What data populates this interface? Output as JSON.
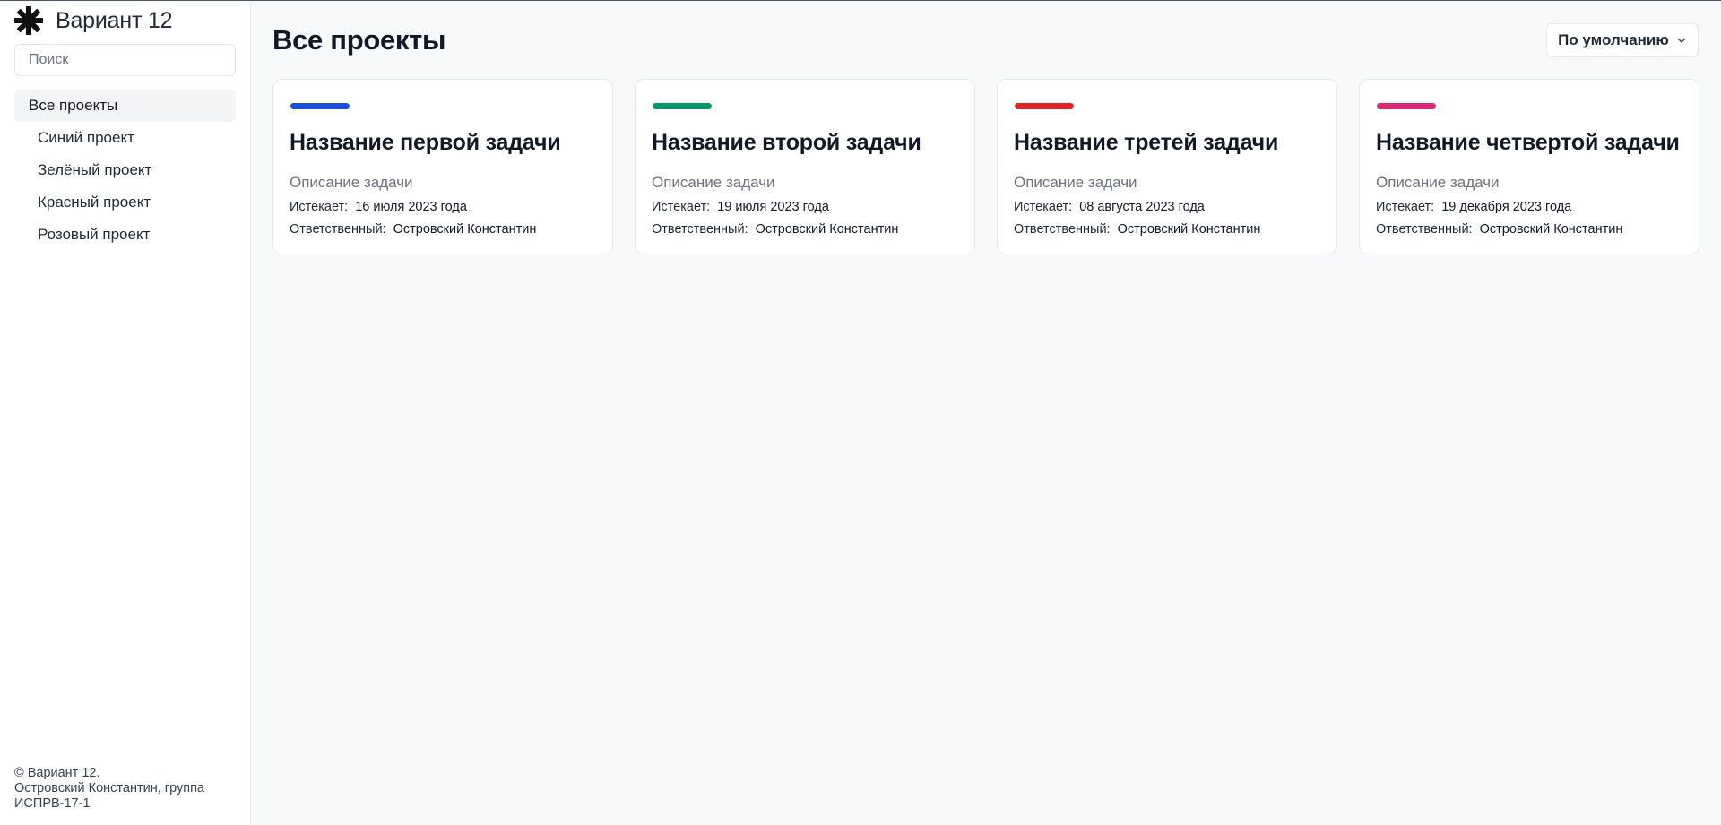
{
  "app": {
    "title": "Вариант 12",
    "logo_icon": "asterisk-icon"
  },
  "search": {
    "placeholder": "Поиск",
    "value": ""
  },
  "sidebar": {
    "items": [
      {
        "label": "Все проекты",
        "active": true
      },
      {
        "label": "Синий проект"
      },
      {
        "label": "Зелёный проект"
      },
      {
        "label": "Красный проект"
      },
      {
        "label": "Розовый проект"
      }
    ]
  },
  "footer": {
    "line1": "© Вариант 12.",
    "line2": "Островский Константин, группа",
    "line3": "ИСПРВ-17-1"
  },
  "header": {
    "title": "Все проекты",
    "sort_label": "По умолчанию",
    "sort_icon": "chevron-down-icon"
  },
  "labels": {
    "expires": "Истекает:",
    "responsible": "Ответственный:"
  },
  "cards": [
    {
      "title": "Название первой задачи",
      "description": "Описание задачи",
      "expires": "16 июля 2023 года",
      "responsible": "Островский Константин",
      "color": "#1d4ed8"
    },
    {
      "title": "Название второй задачи",
      "description": "Описание задачи",
      "expires": "19 июля 2023 года",
      "responsible": "Островский Константин",
      "color": "#059669"
    },
    {
      "title": "Название третей задачи",
      "description": "Описание задачи",
      "expires": "08 августа 2023 года",
      "responsible": "Островский Константин",
      "color": "#dc2626"
    },
    {
      "title": "Название четвертой задачи",
      "description": "Описание задачи",
      "expires": "19 декабря 2023 года",
      "responsible": "Островский Константин",
      "color": "#db2777"
    }
  ]
}
